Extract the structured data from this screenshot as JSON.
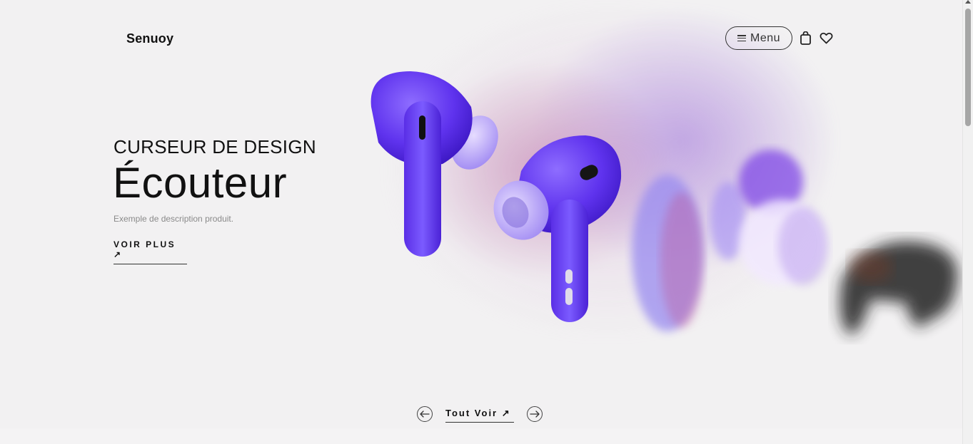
{
  "header": {
    "logo": "Senuoy",
    "menu_label": "Menu",
    "icons": [
      "hamburger-icon",
      "shopping-bag-icon",
      "heart-icon"
    ]
  },
  "hero": {
    "eyebrow": "CURSEUR DE DESIGN",
    "title": "Écouteur",
    "description": "Exemple de description produit.",
    "cta_label": "VOIR PLUS ↗"
  },
  "slider": {
    "prev_icon": "arrow-left-icon",
    "next_icon": "arrow-right-icon",
    "see_all_label": "Tout Voir ↗"
  },
  "colors": {
    "product_purple": "#6a3df0",
    "text": "#111111",
    "background": "#f2f1f2"
  }
}
